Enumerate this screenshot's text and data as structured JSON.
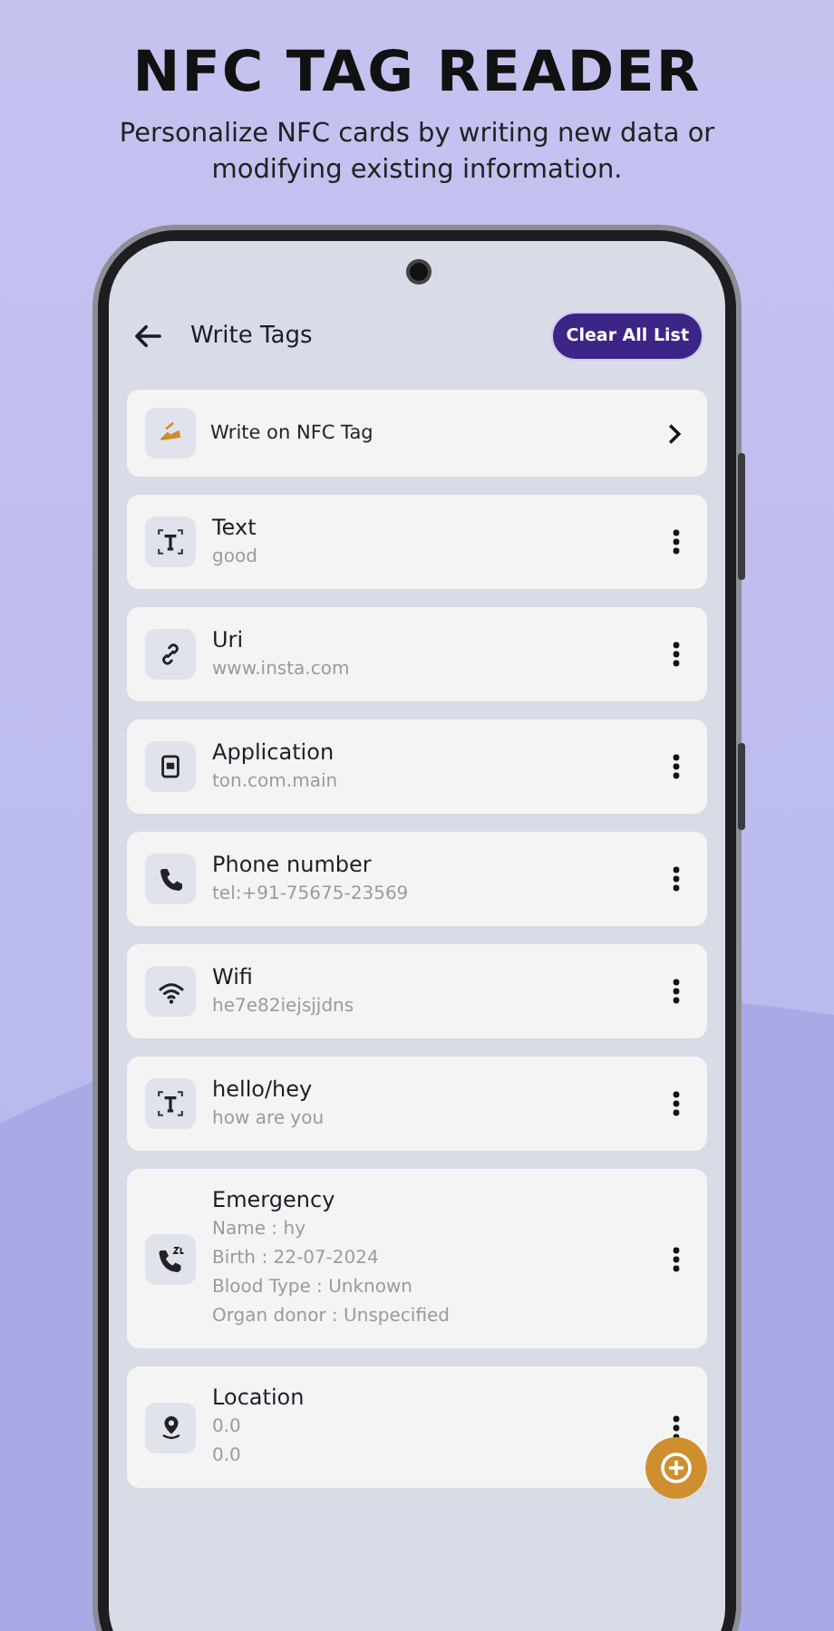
{
  "headline": "NFC TAG READER",
  "subtitle": "Personalize NFC cards by writing new data or modifying existing information.",
  "app_bar": {
    "title": "Write Tags",
    "action": "Clear All List"
  },
  "write_card": {
    "label": "Write on NFC Tag"
  },
  "tags": [
    {
      "kind": "text",
      "title": "Text",
      "lines": [
        "good"
      ]
    },
    {
      "kind": "link",
      "title": "Uri",
      "lines": [
        "www.insta.com"
      ]
    },
    {
      "kind": "app",
      "title": "Application",
      "lines": [
        "ton.com.main"
      ]
    },
    {
      "kind": "phone",
      "title": "Phone number",
      "lines": [
        "tel:+91-75675-23569"
      ]
    },
    {
      "kind": "wifi",
      "title": "Wifi",
      "lines": [
        "he7e82iejsjjdns"
      ]
    },
    {
      "kind": "text",
      "title": "hello/hey",
      "lines": [
        "how are you"
      ]
    },
    {
      "kind": "emergency",
      "title": "Emergency",
      "lines": [
        "Name : hy",
        "Birth : 22-07-2024",
        "Blood Type : Unknown",
        "Organ donor : Unspecified"
      ]
    },
    {
      "kind": "location",
      "title": "Location",
      "lines": [
        "0.0",
        "0.0"
      ]
    }
  ]
}
